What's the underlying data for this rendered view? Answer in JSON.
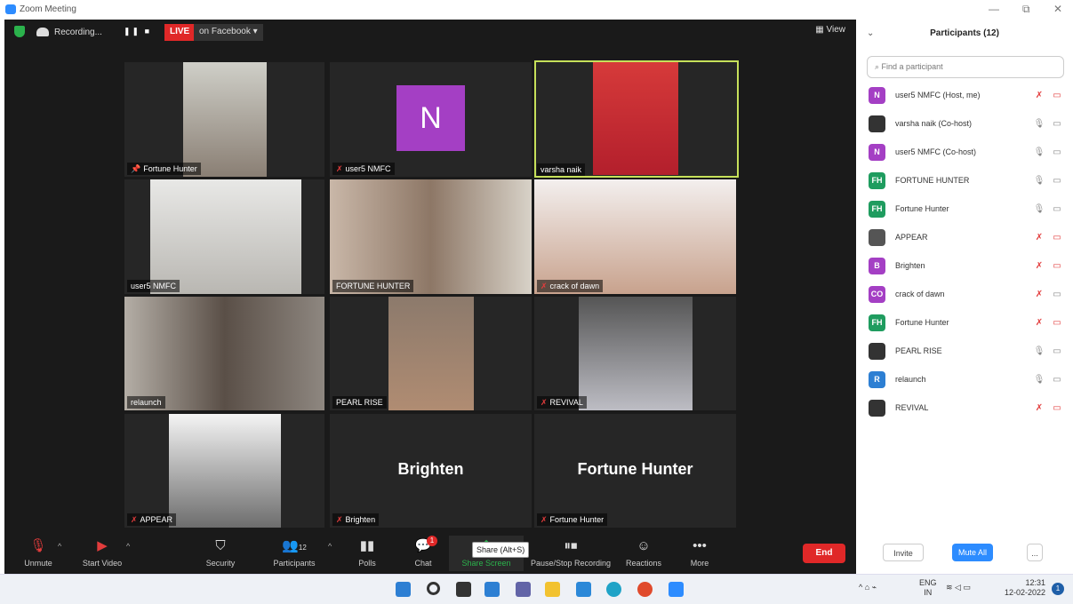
{
  "window": {
    "title": "Zoom Meeting"
  },
  "topbar": {
    "recording": "Recording...",
    "live": "LIVE",
    "live_target": "on Facebook ▾",
    "view": "View"
  },
  "tiles": [
    {
      "name": "Fortune Hunter",
      "muted": false,
      "pinned": true
    },
    {
      "name": "user5 NMFC",
      "muted": true,
      "avatar_letter": "N"
    },
    {
      "name": "varsha naik",
      "muted": false,
      "highlight": true
    },
    {
      "name": "user5 NMFC",
      "muted": false
    },
    {
      "name": "FORTUNE HUNTER",
      "muted": false
    },
    {
      "name": "crack of dawn",
      "muted": true
    },
    {
      "name": "relaunch",
      "muted": false
    },
    {
      "name": "PEARL RISE",
      "muted": false
    },
    {
      "name": "REVIVAL",
      "muted": true
    },
    {
      "name": "APPEAR",
      "muted": true
    },
    {
      "name": "Brighten",
      "muted": true,
      "big_name": "Brighten"
    },
    {
      "name": "Fortune Hunter",
      "muted": true,
      "big_name": "Fortune Hunter"
    }
  ],
  "toolbar": {
    "unmute": "Unmute",
    "start_video": "Start Video",
    "security": "Security",
    "participants": "Participants",
    "participants_count": "12",
    "polls": "Polls",
    "chat": "Chat",
    "chat_badge": "1",
    "share_screen": "Share Screen",
    "share_tooltip": "Share (Alt+S)",
    "pause_recording": "Pause/Stop Recording",
    "reactions": "Reactions",
    "more": "More",
    "end": "End"
  },
  "panel": {
    "title": "Participants (12)",
    "search_placeholder": "Find a participant",
    "participants": [
      {
        "name": "user5 NMFC (Host, me)",
        "avatar": "N",
        "color": "#a43fc4",
        "mic": "muted",
        "video": "off"
      },
      {
        "name": "varsha naik (Co-host)",
        "avatar": "",
        "color": "#333333",
        "mic": "on",
        "video": "on"
      },
      {
        "name": "user5 NMFC (Co-host)",
        "avatar": "N",
        "color": "#a43fc4",
        "mic": "on",
        "video": "on"
      },
      {
        "name": "FORTUNE HUNTER",
        "avatar": "FH",
        "color": "#1f9c5f",
        "mic": "on",
        "video": "on"
      },
      {
        "name": "Fortune Hunter",
        "avatar": "FH",
        "color": "#1f9c5f",
        "mic": "on",
        "video": "on"
      },
      {
        "name": "APPEAR",
        "avatar": "",
        "color": "#555555",
        "mic": "muted",
        "video": "off"
      },
      {
        "name": "Brighten",
        "avatar": "B",
        "color": "#a43fc4",
        "mic": "muted",
        "video": "off"
      },
      {
        "name": "crack of dawn",
        "avatar": "CO",
        "color": "#a43fc4",
        "mic": "muted",
        "video": "on"
      },
      {
        "name": "Fortune Hunter",
        "avatar": "FH",
        "color": "#1f9c5f",
        "mic": "muted",
        "video": "off"
      },
      {
        "name": "PEARL RISE",
        "avatar": "",
        "color": "#333333",
        "mic": "on",
        "video": "on"
      },
      {
        "name": "relaunch",
        "avatar": "R",
        "color": "#2d7fd3",
        "mic": "on",
        "video": "on"
      },
      {
        "name": "REVIVAL",
        "avatar": "",
        "color": "#333333",
        "mic": "muted",
        "video": "off"
      }
    ],
    "invite": "Invite",
    "mute_all": "Mute All",
    "more": "..."
  },
  "taskbar": {
    "lang": "ENG",
    "region": "IN",
    "time": "12:31",
    "date": "12-02-2022"
  }
}
